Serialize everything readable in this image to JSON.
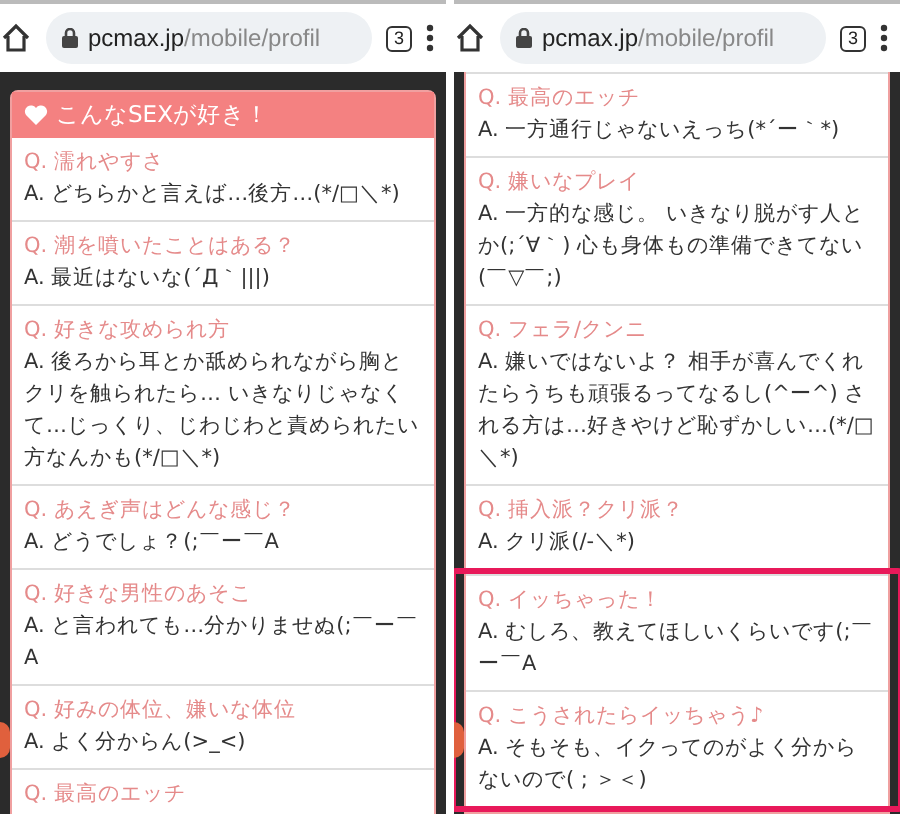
{
  "panels": [
    {
      "browser": {
        "host": "pcmax.jp",
        "path": "/mobile/profil",
        "tab_count": "3"
      },
      "card": {
        "header": "こんなSEXが好き！",
        "items": [
          {
            "q": "Q. 濡れやすさ",
            "a": "A. どちらかと言えば…後方…(*/□＼*)"
          },
          {
            "q": "Q. 潮を噴いたことはある？",
            "a": "A. 最近はないな(´Д｀|||)"
          },
          {
            "q": "Q. 好きな攻められ方",
            "a": "A. 後ろから耳とか舐められながら胸とクリを触られたら… いきなりじゃなくて…じっくり、じわじわと責められたい方なんかも(*/□＼*)"
          },
          {
            "q": "Q. あえぎ声はどんな感じ？",
            "a": "A. どうでしょ？(;￣ー￣A"
          },
          {
            "q": "Q. 好きな男性のあそこ",
            "a": "A. と言われても…分かりませぬ(;￣ー￣A"
          },
          {
            "q": "Q. 好みの体位、嫌いな体位",
            "a": "A. よく分からん(>_<)"
          },
          {
            "q": "Q. 最高のエッチ"
          }
        ]
      }
    },
    {
      "browser": {
        "host": "pcmax.jp",
        "path": "/mobile/profil",
        "tab_count": "3"
      },
      "card": {
        "items": [
          {
            "q": "Q. 最高のエッチ",
            "a": "A. 一方通行じゃないえっち(*´ー｀*)"
          },
          {
            "q": "Q. 嫌いなプレイ",
            "a": "A. 一方的な感じ。 いきなり脱がす人とか(;´∀｀) 心も身体もの準備できてない(￣▽￣;)"
          },
          {
            "q": "Q. フェラ/クンニ",
            "a": "A. 嫌いではないよ？ 相手が喜んでくれたらうちも頑張るってなるし(^ー^) される方は…好きやけど恥ずかしい…(*/□＼*)"
          },
          {
            "q": "Q. 挿入派？クリ派？",
            "a": "A. クリ派(/-＼*)"
          }
        ],
        "highlighted_items": [
          {
            "q": "Q. イッちゃった！",
            "a": "A. むしろ、教えてほしいくらいです(;￣ー￣A"
          },
          {
            "q": "Q. こうされたらイッちゃう♪",
            "a": "A. そもそも、イクってのがよく分からないので( ; ＞＜)"
          }
        ]
      }
    }
  ]
}
